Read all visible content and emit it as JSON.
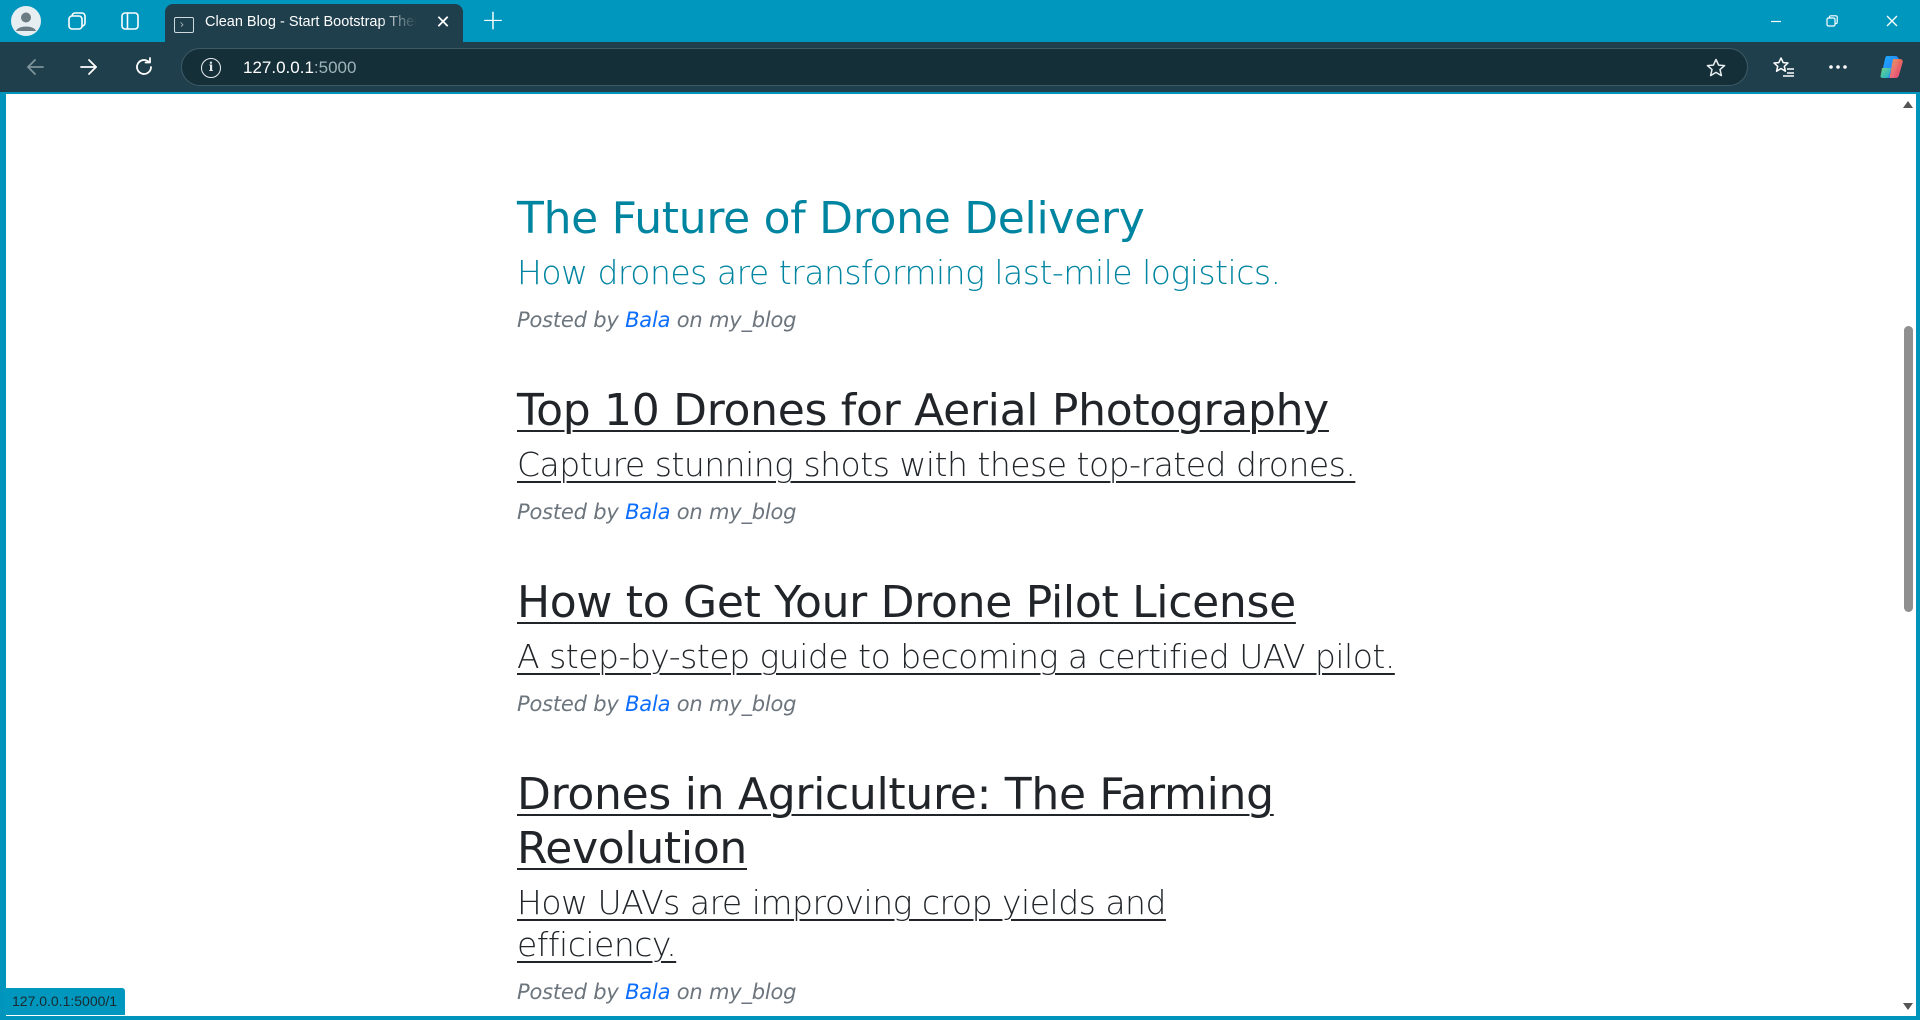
{
  "browser": {
    "tab": {
      "title": "Clean Blog - Start Bootstrap Theme",
      "close_icon": "close-icon"
    },
    "address": {
      "host": "127.0.0.1",
      "port": ":5000"
    },
    "status_url": "127.0.0.1:5000/1",
    "colors": {
      "accent": "#0097be",
      "toolbar": "#1f3f4c"
    }
  },
  "posts": [
    {
      "title": "The Future of Drone Delivery",
      "subtitle": "How drones are transforming last-mile logistics.",
      "posted_by": "Posted by",
      "author": "Bala",
      "on": "on my_blog",
      "state": "hover"
    },
    {
      "title": "Top 10 Drones for Aerial Photography",
      "subtitle": "Capture stunning shots with these top-rated drones.",
      "posted_by": "Posted by",
      "author": "Bala",
      "on": "on my_blog"
    },
    {
      "title": "How to Get Your Drone Pilot License",
      "subtitle": "A step-by-step guide to becoming a certified UAV pilot.",
      "posted_by": "Posted by",
      "author": "Bala",
      "on": "on my_blog"
    },
    {
      "title": "Drones in Agriculture: The Farming Revolution",
      "subtitle": "How UAVs are improving crop yields and efficiency.",
      "posted_by": "Posted by",
      "author": "Bala",
      "on": "on my_blog"
    }
  ]
}
